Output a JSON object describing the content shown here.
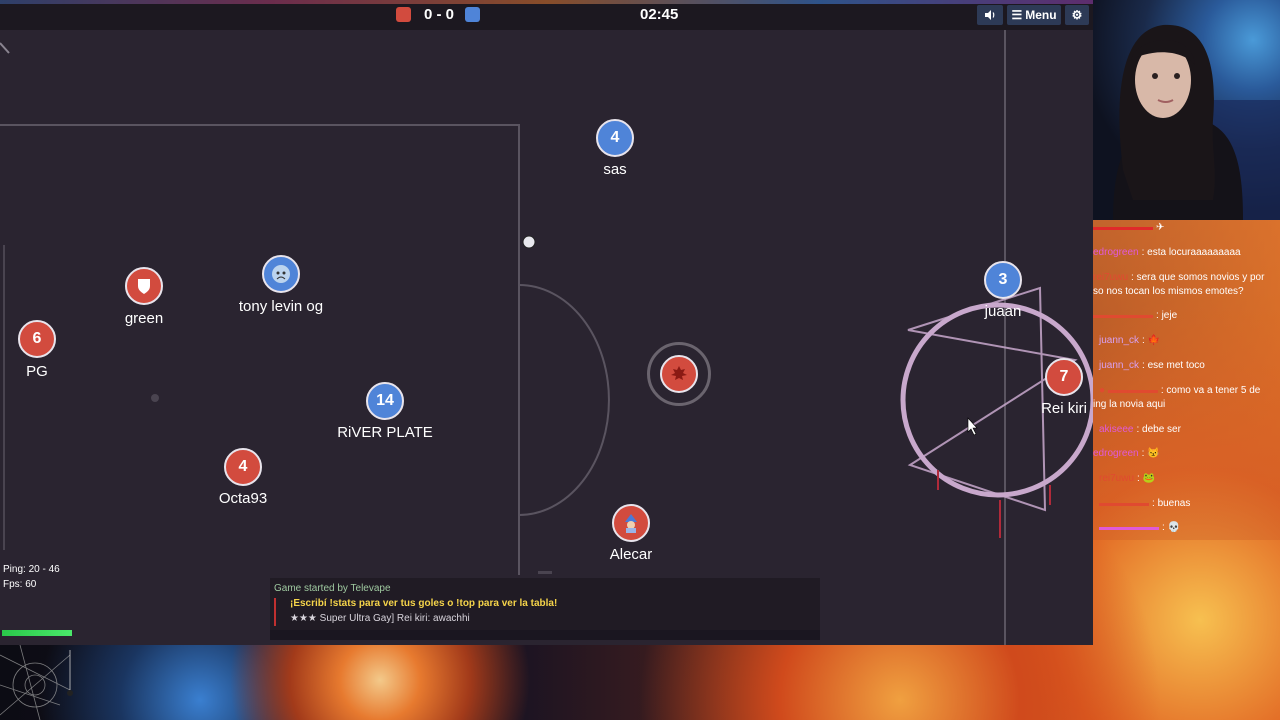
{
  "score": {
    "red": "0",
    "sep": "-",
    "blue": "0",
    "display": "0 - 0"
  },
  "timer": "02:45",
  "toolbar": {
    "sound_icon": "speaker-icon",
    "menu_label": "Menu",
    "menu_icon": "hamburger-icon",
    "settings_icon": "gear-icon"
  },
  "colors": {
    "red_team": "#d24b3e",
    "blue_team": "#4f84d8",
    "field": "#2a2430",
    "field_lines": "#5a5460"
  },
  "players": [
    {
      "name": "sas",
      "number": "4",
      "team": "blue"
    },
    {
      "name": "green",
      "number": "",
      "team": "red",
      "avatar": "shield-icon"
    },
    {
      "name": "tony levin og",
      "number": "",
      "team": "blue",
      "avatar": "crying-face-icon"
    },
    {
      "name": "PG",
      "number": "6",
      "team": "red"
    },
    {
      "name": "RiVER PLATE",
      "number": "14",
      "team": "blue"
    },
    {
      "name": "Octa93",
      "number": "4",
      "team": "red"
    },
    {
      "name": "Alecar",
      "number": "",
      "team": "red",
      "avatar": "mage-icon"
    },
    {
      "name": "juaan",
      "number": "3",
      "team": "blue"
    },
    {
      "name": "Rei kiri",
      "number": "7",
      "team": "red"
    },
    {
      "name": "",
      "number": "",
      "team": "red",
      "avatar": "maple-leaf-icon"
    }
  ],
  "stats": {
    "ping": "Ping: 20 - 46",
    "fps": "Fps: 60"
  },
  "game_chat": [
    {
      "text": "Game started by Televape",
      "color": "#9fc9a0"
    },
    {
      "text": "¡Escribí !stats para ver tus goles o !top para ver la tabla!",
      "color": "#f5d44a"
    },
    {
      "text": "★★★ Super Ultra Gay] Rei kiri: awachhi",
      "color": "#d8d4dc"
    }
  ],
  "stream_chat": [
    {
      "user": "",
      "msg": ""
    },
    {
      "user": "edrogreen",
      "msg": "esta locuraaaaaaaaa",
      "color": "#e05ad8"
    },
    {
      "user": "rei7uwu",
      "msg": "sera que somos novios y por",
      "color": "#e04a30"
    },
    {
      "user": "",
      "msg": "so nos tocan los mismos emotes?"
    },
    {
      "user": "",
      "msg": "jeje",
      "color": "#e04a30"
    },
    {
      "user": "juann_ck",
      "msg": "",
      "color": "#d8a0f0"
    },
    {
      "user": "juann_ck",
      "msg": "ese met toco",
      "color": "#d8a0f0"
    },
    {
      "user": "",
      "msg": "como va a tener 5 de",
      "color": "#e04a30"
    },
    {
      "user": "",
      "msg": "ing la novia aqui"
    },
    {
      "user": "akiseee",
      "msg": "debe ser",
      "color": "#e05ad8"
    },
    {
      "user": "edrogreen",
      "msg": "",
      "color": "#e05ad8"
    },
    {
      "user": "rei7uwu",
      "msg": "",
      "color": "#e04a30"
    },
    {
      "user": "",
      "msg": "buenas",
      "color": "#e04a30"
    },
    {
      "user": "",
      "msg": "",
      "color": "#e05ad8"
    }
  ]
}
